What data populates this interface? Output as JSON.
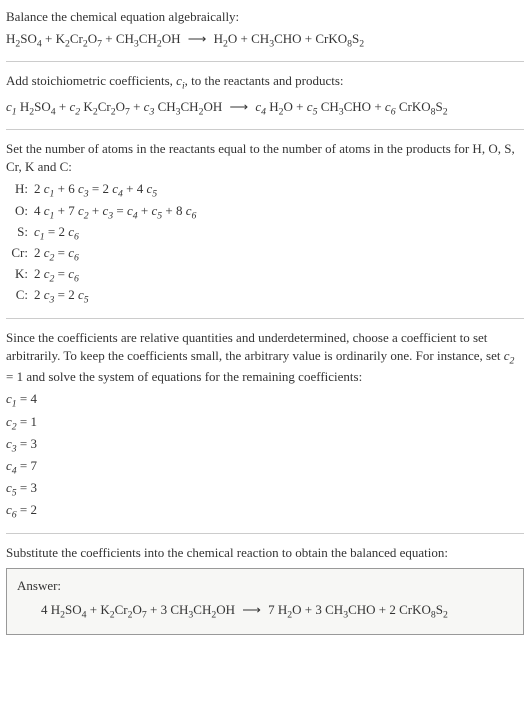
{
  "intro": {
    "line1": "Balance the chemical equation algebraically:"
  },
  "equation1": {
    "lhs": [
      {
        "formula": "H_2SO_4"
      },
      {
        "formula": "K_2Cr_2O_7"
      },
      {
        "formula": "CH_3CH_2OH"
      }
    ],
    "rhs": [
      {
        "formula": "H_2O"
      },
      {
        "formula": "CH_3CHO"
      },
      {
        "formula": "CrKO_8S_2"
      }
    ]
  },
  "stoich": {
    "text": "Add stoichiometric coefficients, ",
    "ci": "c_i",
    "text2": ", to the reactants and products:"
  },
  "equation2": {
    "lhs": [
      {
        "coef": "c_1",
        "formula": "H_2SO_4"
      },
      {
        "coef": "c_2",
        "formula": "K_2Cr_2O_7"
      },
      {
        "coef": "c_3",
        "formula": "CH_3CH_2OH"
      }
    ],
    "rhs": [
      {
        "coef": "c_4",
        "formula": "H_2O"
      },
      {
        "coef": "c_5",
        "formula": "CH_3CHO"
      },
      {
        "coef": "c_6",
        "formula": "CrKO_8S_2"
      }
    ]
  },
  "atoms": {
    "intro": "Set the number of atoms in the reactants equal to the number of atoms in the products for H, O, S, Cr, K and C:",
    "rows": [
      {
        "el": "H:",
        "eq": "2 c_1 + 6 c_3 = 2 c_4 + 4 c_5"
      },
      {
        "el": "O:",
        "eq": "4 c_1 + 7 c_2 + c_3 = c_4 + c_5 + 8 c_6"
      },
      {
        "el": "S:",
        "eq": "c_1 = 2 c_6"
      },
      {
        "el": "Cr:",
        "eq": "2 c_2 = c_6"
      },
      {
        "el": "K:",
        "eq": "2 c_2 = c_6"
      },
      {
        "el": "C:",
        "eq": "2 c_3 = 2 c_5"
      }
    ]
  },
  "underdet": {
    "text": "Since the coefficients are relative quantities and underdetermined, choose a coefficient to set arbitrarily. To keep the coefficients small, the arbitrary value is ordinarily one. For instance, set c_2 = 1 and solve the system of equations for the remaining coefficients:"
  },
  "coeffs": [
    {
      "name": "c_1",
      "val": "4"
    },
    {
      "name": "c_2",
      "val": "1"
    },
    {
      "name": "c_3",
      "val": "3"
    },
    {
      "name": "c_4",
      "val": "7"
    },
    {
      "name": "c_5",
      "val": "3"
    },
    {
      "name": "c_6",
      "val": "2"
    }
  ],
  "subst": {
    "text": "Substitute the coefficients into the chemical reaction to obtain the balanced equation:"
  },
  "answer": {
    "label": "Answer:",
    "lhs": [
      {
        "coef": "4",
        "formula": "H_2SO_4"
      },
      {
        "coef": "",
        "formula": "K_2Cr_2O_7"
      },
      {
        "coef": "3",
        "formula": "CH_3CH_2OH"
      }
    ],
    "rhs": [
      {
        "coef": "7",
        "formula": "H_2O"
      },
      {
        "coef": "3",
        "formula": "CH_3CHO"
      },
      {
        "coef": "2",
        "formula": "CrKO_8S_2"
      }
    ]
  }
}
